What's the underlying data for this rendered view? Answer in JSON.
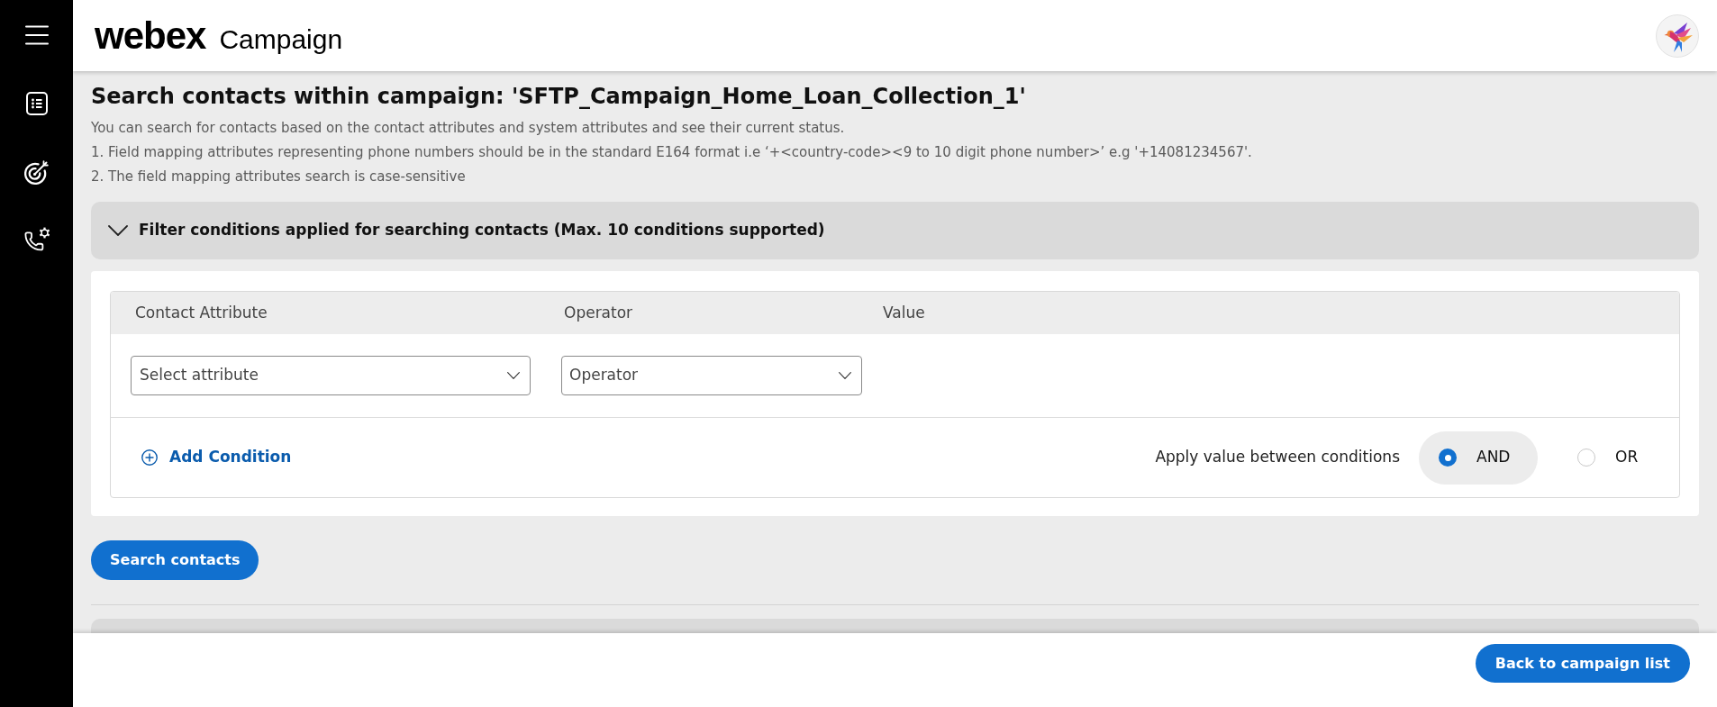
{
  "header": {
    "logo": "webex",
    "app_name": "Campaign"
  },
  "page": {
    "title": "Search contacts within campaign: 'SFTP_Campaign_Home_Loan_Collection_1'",
    "description": [
      "You can search for contacts based on the contact attributes and system attributes and see their current status.",
      "1. Field mapping attributes representing phone numbers should be in the standard E164 format i.e ‘+<country-code><9 to 10 digit phone number>’ e.g '+14081234567'.",
      "2. The field mapping attributes search is case-sensitive"
    ]
  },
  "filter": {
    "title": "Filter conditions applied for searching contacts (Max. 10 conditions supported)",
    "expanded": true,
    "columns": [
      "Contact Attribute",
      "Operator",
      "Value"
    ],
    "conditions": [
      {
        "attribute": {
          "placeholder": "Select attribute"
        },
        "operator": {
          "placeholder": "Operator"
        }
      }
    ],
    "add_condition": "Add Condition",
    "logic": {
      "label": "Apply value between conditions",
      "options": [
        {
          "label": "AND",
          "selected": true
        },
        {
          "label": "OR",
          "selected": false
        }
      ]
    }
  },
  "search_button": "Search contacts",
  "footer": {
    "back_button": "Back to campaign list"
  }
}
